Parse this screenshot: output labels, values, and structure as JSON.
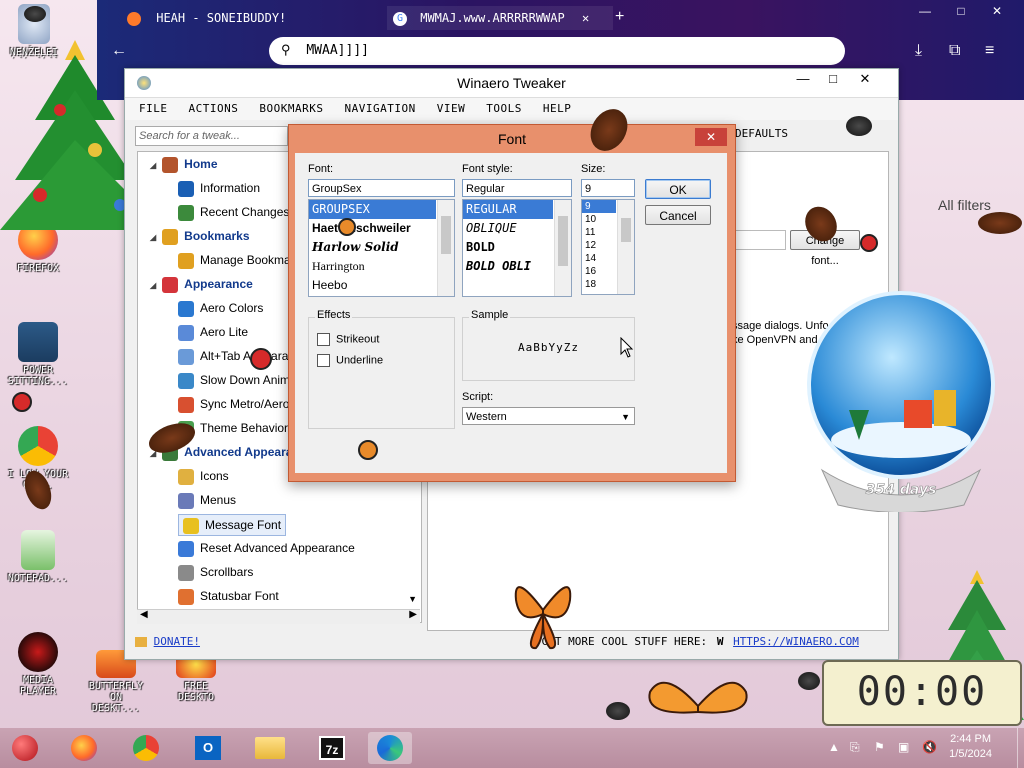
{
  "desktop": {
    "icons": [
      {
        "id": "recycle-bin",
        "label": "ŅĘŅŽĘĻĘĮ"
      },
      {
        "id": "firefox",
        "label": "FIREFOX"
      },
      {
        "id": "power-settings",
        "label": "POWER SITTING..."
      },
      {
        "id": "chrome",
        "label": "I LOW YOUR OP..."
      },
      {
        "id": "notepad",
        "label": "NOTEPAD..."
      },
      {
        "id": "media-player",
        "label": "MEDIA PLAYER"
      },
      {
        "id": "butterfly",
        "label": "BUTTERFLY ON DESKT..."
      },
      {
        "id": "free-desktop",
        "label": "FREE DESKTO"
      }
    ]
  },
  "browser": {
    "tabs": [
      {
        "title": "HEAH - SONEIBUDDY!",
        "icon": "firefox-icon"
      },
      {
        "title": "MWMAJ.www.ARRRRRWWAP",
        "icon": "google-icon"
      }
    ],
    "address": "MWAA]]]]",
    "new_tab": "+",
    "ctl": {
      "min": "—",
      "max": "□",
      "close": "✕"
    }
  },
  "tweaker": {
    "title": "Winaero Tweaker",
    "menu": [
      "FILE",
      "ACTIONS",
      "BOOKMARKS",
      "NAVIGATION",
      "VIEW",
      "TOOLS",
      "HELP"
    ],
    "search_placeholder": "Search for a tweak...",
    "reset_label": "DEFAULTS",
    "tree": [
      {
        "label": "Home",
        "type": "cat",
        "color": "#b3542c"
      },
      {
        "label": "Information",
        "type": "leaf",
        "color": "#1a5fb4"
      },
      {
        "label": "Recent Changes",
        "type": "leaf",
        "color": "#3c8a3c"
      },
      {
        "label": "Bookmarks",
        "type": "cat",
        "color": "#e0a020"
      },
      {
        "label": "Manage Bookmarks",
        "type": "leaf",
        "color": "#e0a020"
      },
      {
        "label": "Appearance",
        "type": "cat",
        "color": "#d4343a"
      },
      {
        "label": "Aero Colors",
        "type": "leaf",
        "color": "#2a78d0"
      },
      {
        "label": "Aero Lite",
        "type": "leaf",
        "color": "#5a8ad8"
      },
      {
        "label": "Alt+Tab Appearance",
        "type": "leaf",
        "color": "#6a9ad8"
      },
      {
        "label": "Slow Down Animations",
        "type": "leaf",
        "color": "#3a88c8"
      },
      {
        "label": "Sync Metro/Aero",
        "type": "leaf",
        "color": "#d85030"
      },
      {
        "label": "Theme Behavior",
        "type": "leaf",
        "color": "#4aa050"
      },
      {
        "label": "Advanced Appearance",
        "type": "cat",
        "color": "#3a7a3a"
      },
      {
        "label": "Icons",
        "type": "leaf",
        "color": "#e0b040"
      },
      {
        "label": "Menus",
        "type": "leaf",
        "color": "#6a7ab8"
      },
      {
        "label": "Message Font",
        "type": "leaf",
        "color": "#e8c020",
        "selected": true
      },
      {
        "label": "Reset Advanced Appearance",
        "type": "leaf",
        "color": "#3a7ad8"
      },
      {
        "label": "Scrollbars",
        "type": "leaf",
        "color": "#8a8a8a"
      },
      {
        "label": "Statusbar Font",
        "type": "leaf",
        "color": "#e07030"
      }
    ],
    "right_pane": {
      "change_font_label": "Change font...",
      "desc_1": "ssage dialogs. Unfo",
      "desc_2": "ke OpenVPN and"
    },
    "status": {
      "donate": "DONATE!",
      "promo": "GET MORE COOL STUFF HERE:",
      "link": "HTTPS://WINAERO.COM"
    }
  },
  "font_dialog": {
    "title": "Font",
    "close": "✕",
    "font_label": "Font:",
    "font_value": "GroupSex",
    "fonts": [
      "GROUPSEX",
      "Haettenschweiler",
      "Harlow Solid",
      "Harrington",
      "Heebo"
    ],
    "style_label": "Font style:",
    "style_value": "Regular",
    "styles": [
      "REGULAR",
      "OBLIQUE",
      "BOLD",
      "BOLD OBLI"
    ],
    "size_label": "Size:",
    "size_value": "9",
    "sizes": [
      "9",
      "10",
      "11",
      "12",
      "14",
      "16",
      "18"
    ],
    "ok": "OK",
    "cancel": "Cancel",
    "effects_label": "Effects",
    "strikeout": "Strikeout",
    "underline": "Underline",
    "sample_label": "Sample",
    "sample_text": "AaBbYyZz",
    "script_label": "Script:",
    "script_value": "Western"
  },
  "background_window": {
    "all_filters": "All filters"
  },
  "decor": {
    "globe_days": "354 days",
    "timer": "00:00"
  },
  "taskbar": {
    "apps": [
      "firefox",
      "chrome",
      "outlook",
      "file-explorer",
      "7zip",
      "edge"
    ],
    "time": "2:44 PM",
    "date": "1/5/2024"
  }
}
